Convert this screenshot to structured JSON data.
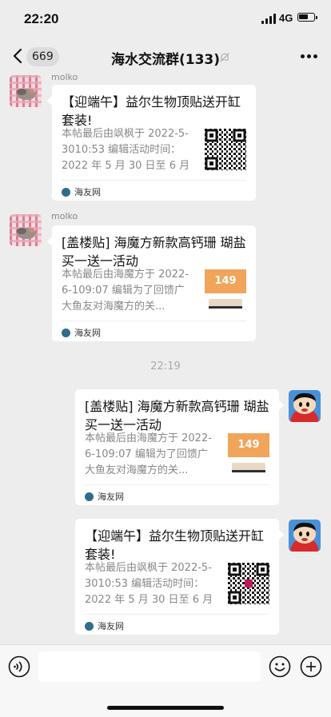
{
  "status_bar": {
    "time": "22:20",
    "network": "4G"
  },
  "nav": {
    "back_count": "669",
    "title": "海水交流群(133)"
  },
  "messages": [
    {
      "sender": "molko",
      "title": "【迎端午】益尔生物顶贴送开缸套装!",
      "description": "本帖最后由飒枫于 2022-5-3010:53 编辑活动时间：2022 年 5 月 30 日至 6 月 ...",
      "source": "海友网"
    },
    {
      "sender": "molko",
      "title": "[盖楼贴] 海魔方新款高钙珊 瑚盐买一送一活动",
      "description": "本帖最后由海魔方于 2022-6-109:07 编辑为了回馈广大鱼友对海魔方的关...",
      "thumb_text": "149",
      "source": "海友网"
    },
    {
      "title": "[盖楼贴] 海魔方新款高钙珊 瑚盐买一送一活动",
      "description": "本帖最后由海魔方于 2022-6-109:07 编辑为了回馈广大鱼友对海魔方的关...",
      "thumb_text": "149",
      "source": "海友网"
    },
    {
      "title": "【迎端午】益尔生物顶贴送开缸套装!",
      "description": "本帖最后由飒枫于 2022-5-3010:53 编辑活动时间：2022 年 5 月 30 日至 6 月 ...",
      "source": "海友网"
    }
  ],
  "timestamp": "22:19",
  "icons": {
    "back": "chevron-left-icon",
    "mute": "bell-off-icon",
    "more": "more-dots-icon",
    "voice": "voice-icon",
    "emoji": "emoji-icon",
    "plus": "plus-icon"
  }
}
